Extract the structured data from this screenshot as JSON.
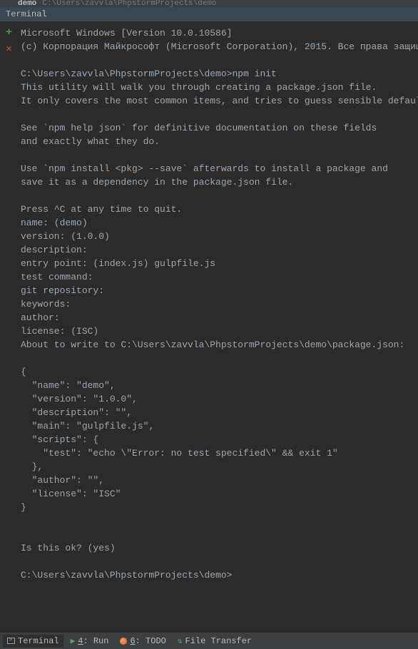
{
  "tabs": {
    "project_label": "demo",
    "path_hint": "C:\\Users\\zavvla\\PhpstormProjects\\demo"
  },
  "terminal": {
    "header": "Terminal",
    "output": "Microsoft Windows [Version 10.0.10586]\n(c) Корпорация Майкрософт (Microsoft Corporation), 2015. Все права защищены.\n\nC:\\Users\\zavvla\\PhpstormProjects\\demo>npm init\nThis utility will walk you through creating a package.json file.\nIt only covers the most common items, and tries to guess sensible defaults.\n\nSee `npm help json` for definitive documentation on these fields\nand exactly what they do.\n\nUse `npm install <pkg> --save` afterwards to install a package and\nsave it as a dependency in the package.json file.\n\nPress ^C at any time to quit.\nname: (demo)\nversion: (1.0.0)\ndescription:\nentry point: (index.js) gulpfile.js\ntest command:\ngit repository:\nkeywords:\nauthor:\nlicense: (ISC)\nAbout to write to C:\\Users\\zavvla\\PhpstormProjects\\demo\\package.json:\n\n{\n  \"name\": \"demo\",\n  \"version\": \"1.0.0\",\n  \"description\": \"\",\n  \"main\": \"gulpfile.js\",\n  \"scripts\": {\n    \"test\": \"echo \\\"Error: no test specified\\\" && exit 1\"\n  },\n  \"author\": \"\",\n  \"license\": \"ISC\"\n}\n\n\nIs this ok? (yes)\n\nC:\\Users\\zavvla\\PhpstormProjects\\demo>"
  },
  "status": {
    "terminal_label": "Terminal",
    "run_key": "4",
    "run_label": ": Run",
    "todo_key": "6",
    "todo_label": ": TODO",
    "filetransfer_label": "File Transfer"
  }
}
